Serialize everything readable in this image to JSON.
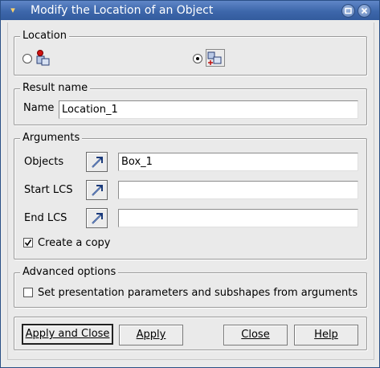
{
  "window": {
    "title": "Modify the Location of an Object",
    "title_icon": "gear-icon"
  },
  "location": {
    "legend": "Location",
    "options": [
      {
        "icon": "location-by-coords-icon",
        "selected": false
      },
      {
        "icon": "location-by-lcs-icon",
        "selected": true
      }
    ]
  },
  "result": {
    "legend": "Result name",
    "name_label": "Name",
    "name_value": "Location_1"
  },
  "arguments": {
    "legend": "Arguments",
    "objects_label": "Objects",
    "objects_value": "Box_1",
    "start_lcs_label": "Start LCS",
    "start_lcs_value": "",
    "end_lcs_label": "End LCS",
    "end_lcs_value": "",
    "select_icon": "select-arrow-icon",
    "copy_label": "Create a copy",
    "copy_checked": true
  },
  "advanced": {
    "legend": "Advanced options",
    "presentation_label": "Set presentation parameters and subshapes from arguments",
    "presentation_checked": false
  },
  "buttons": {
    "apply_close": "Apply and Close",
    "apply": "Apply",
    "close": "Close",
    "help": "Help"
  }
}
